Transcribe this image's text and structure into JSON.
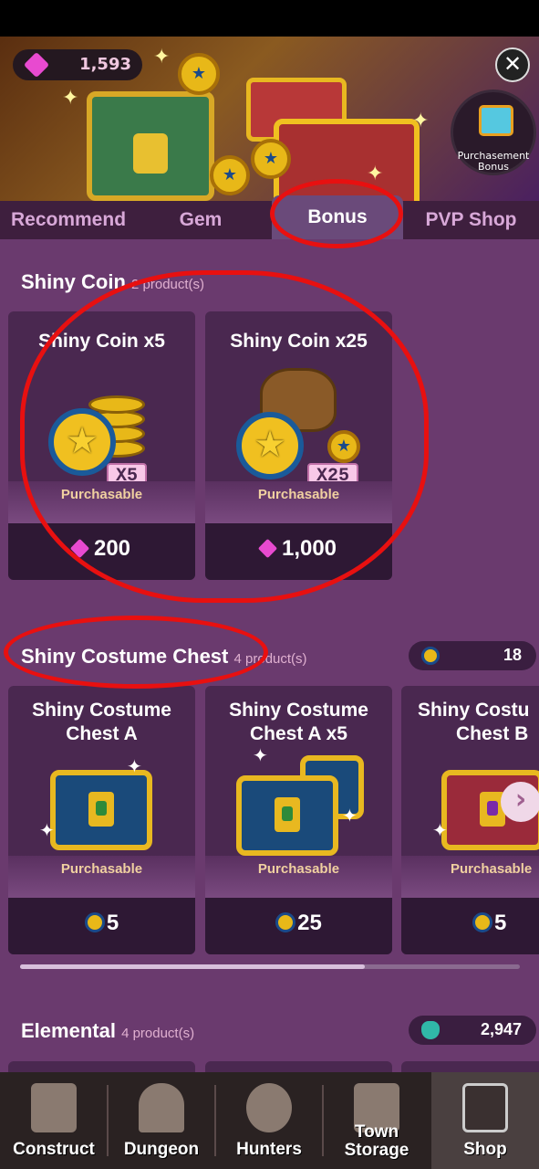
{
  "header": {
    "gem_count": "1,593",
    "close_label": "✕",
    "purchase_bonus_label": "Purchasement Bonus"
  },
  "tabs": [
    {
      "label": "Recommend"
    },
    {
      "label": "Gem"
    },
    {
      "label": "Bonus"
    },
    {
      "label": "PVP Shop"
    }
  ],
  "sections": [
    {
      "title": "Shiny Coin",
      "count": "2 product(s)",
      "products": [
        {
          "name": "Shiny Coin x5",
          "multiplier": "X5",
          "status": "Purchasable",
          "price": "200"
        },
        {
          "name": "Shiny Coin x25",
          "multiplier": "X25",
          "status": "Purchasable",
          "price": "1,000"
        }
      ]
    },
    {
      "title": "Shiny Costume Chest",
      "count": "4 product(s)",
      "balance": "18",
      "products": [
        {
          "name_line1": "Shiny Costume",
          "name_line2": "Chest A",
          "status": "Purchasable",
          "price": "5"
        },
        {
          "name_line1": "Shiny Costume",
          "name_line2": "Chest A x5",
          "status": "Purchasable",
          "price": "25"
        },
        {
          "name_line1": "Shiny Costu",
          "name_line2": "Chest B",
          "status": "Purchasable",
          "price": "5"
        }
      ]
    },
    {
      "title": "Elemental",
      "count": "4 product(s)",
      "balance": "2,947"
    }
  ],
  "nav": [
    {
      "label": "Construct",
      "icon": "hammer-icon"
    },
    {
      "label": "Dungeon",
      "icon": "dungeon-gate-icon"
    },
    {
      "label": "Hunters",
      "icon": "hunter-emblem-icon"
    },
    {
      "label": "Town Storage",
      "icon": "storage-chest-icon"
    },
    {
      "label": "Shop",
      "icon": "shop-stall-icon"
    }
  ],
  "colors": {
    "background": "#6a3a6e",
    "card": "#4a2850",
    "accent_gem": "#e84ad0",
    "annotation": "#e81010"
  }
}
